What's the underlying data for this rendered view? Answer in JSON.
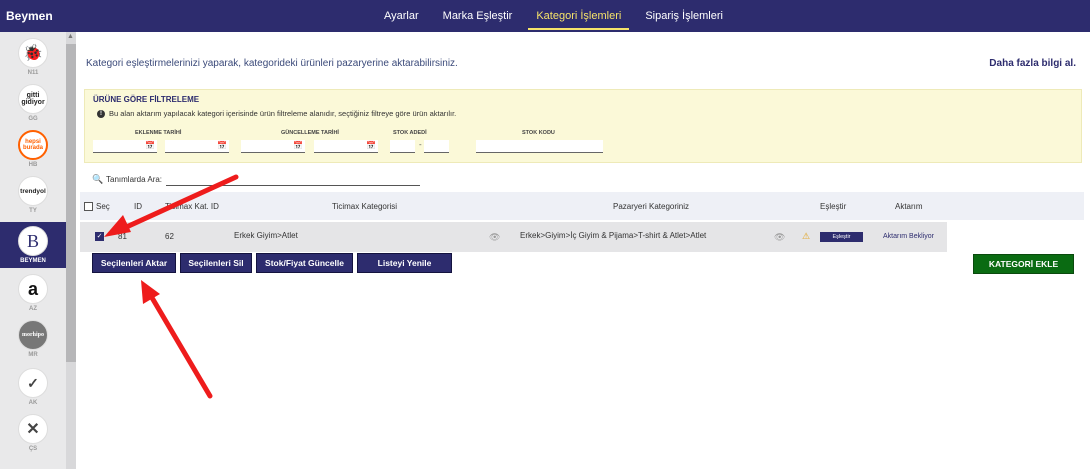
{
  "app": {
    "brand": "Beymen"
  },
  "nav": [
    {
      "label": "Ayarlar",
      "active": false
    },
    {
      "label": "Marka Eşleştir",
      "active": false
    },
    {
      "label": "Kategori İşlemleri",
      "active": true
    },
    {
      "label": "Sipariş İşlemleri",
      "active": false
    }
  ],
  "marketplaces": [
    {
      "logo": "🐞",
      "code": "N11"
    },
    {
      "logo": "gitti gidiyor",
      "code": "GG"
    },
    {
      "logo": "hepsi burada",
      "code": "HB"
    },
    {
      "logo": "trendyol",
      "code": "TY"
    },
    {
      "logo": "B",
      "code": "BEYMEN",
      "active": true
    },
    {
      "logo": "a",
      "code": "AZ"
    },
    {
      "logo": "morhipo",
      "code": "MR"
    },
    {
      "logo": "✓",
      "code": "AK"
    },
    {
      "logo": "✕",
      "code": "ÇS"
    }
  ],
  "page": {
    "description": "Kategori eşleştirmelerinizi yaparak, kategorideki ürünleri pazaryerine aktarabilirsiniz.",
    "more_link": "Daha fazla bilgi al."
  },
  "filter": {
    "title": "ÜRÜNE GÖRE FİLTRELEME",
    "info": "Bu alan aktarım yapılacak kategori içerisinde ürün filtreleme alanıdır, seçtiğiniz filtreye göre ürün aktarılır.",
    "labels": {
      "created": "EKLENME TARİHİ",
      "updated": "GÜNCELLEME TARİHİ",
      "stock_count": "STOK ADEDİ",
      "stock_code": "STOK KODU"
    }
  },
  "search": {
    "label": "Tanımlarda Ara:",
    "value": ""
  },
  "table": {
    "headers": {
      "select": "Seç",
      "id": "ID",
      "ticimax_id": "Ticimax Kat. ID",
      "ticimax_category": "Ticimax Kategorisi",
      "marketplace_category": "Pazaryeri Kategoriniz",
      "match": "Eşleştir",
      "transfer": "Aktarım"
    },
    "rows": [
      {
        "checked": true,
        "id": "81",
        "ticimax_id": "62",
        "ticimax_category": "Erkek Giyim>Atlet",
        "marketplace_category": "Erkek>Giyim>İç Giyim & Pijama>T-shirt & Atlet>Atlet",
        "match_button": "Eşleştir",
        "transfer_status": "Aktarım Bekliyor"
      }
    ]
  },
  "actions": {
    "transfer_selected": "Seçilenleri Aktar",
    "delete_selected": "Seçilenleri Sil",
    "update_stock_price": "Stok/Fiyat Güncelle",
    "refresh_list": "Listeyi Yenile",
    "add_category": "KATEGORİ EKLE"
  },
  "colors": {
    "primary": "#2d2c6e",
    "active_nav": "#f6e36a",
    "filter_bg": "#fbf9d8",
    "add_button": "#0a6b12",
    "annotation_arrow": "#ee1c1c",
    "warning": "#e2a21b"
  }
}
